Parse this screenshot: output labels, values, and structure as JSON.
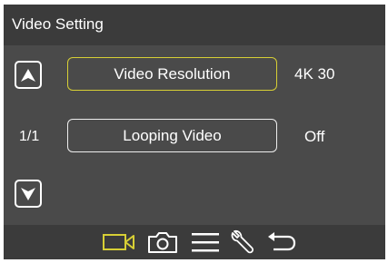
{
  "header": {
    "title": "Video Setting"
  },
  "nav": {
    "page_indicator": "1/1",
    "up_icon": "arrow-up-icon",
    "down_icon": "arrow-down-icon"
  },
  "menu": {
    "items": [
      {
        "label": "Video Resolution",
        "value": "4K 30",
        "selected": true
      },
      {
        "label": "Looping Video",
        "value": "Off",
        "selected": false
      }
    ]
  },
  "footer": {
    "icons": [
      "video-camera-icon",
      "camera-icon",
      "menu-icon",
      "wrench-icon",
      "back-icon"
    ],
    "active_icon": "video-camera-icon"
  },
  "colors": {
    "accent": "#d7cf35",
    "background": "#4a4a4a",
    "bar": "#3b3b3b",
    "text": "#ffffff"
  }
}
